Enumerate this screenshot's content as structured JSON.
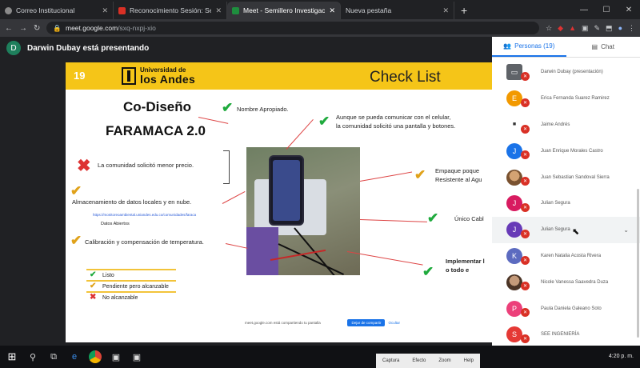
{
  "browser": {
    "tabs": [
      {
        "title": "Correo Institucional",
        "color": "#8a8a8a",
        "active": false
      },
      {
        "title": "Reconocimiento Sesión: Semillero",
        "color": "#d93025",
        "active": false
      },
      {
        "title": "Meet - Semillero Investigac...",
        "color": "#1e8e3e",
        "active": true
      },
      {
        "title": "Nueva pestaña",
        "color": "#5f6368",
        "active": false
      }
    ],
    "new_tab": "+",
    "url_host": "meet.google.com",
    "url_path": "/sxq-nxpj-xio"
  },
  "meet": {
    "presenter_initial": "D",
    "presenting_text": "Darwin Dubay está presentando",
    "notice_text": "meet.google.com está compartiendo tu pantalla",
    "notice_stop": "Dejar de compartir",
    "notice_hide": "Ocultar"
  },
  "slide": {
    "number": "19",
    "uni_line1": "Universidad de",
    "uni_line2": "los Andes",
    "heading": "Check List",
    "title1": "Co-Diseño",
    "title2": "FARAMACA 2.0",
    "items": {
      "nombre": "Nombre Apropiado.",
      "celular": "Aunque se pueda comunicar con el celular,\nla comunidad solicitó una pantalla y botones.",
      "precio": "La comunidad solicitó menor precio.",
      "almacenamiento": "Almacenamiento de datos locales y en nube.",
      "link": "https://monitoreoambiental.uniandes.edu.co/comunidades/faraca",
      "datos": "Datos Abiertos",
      "calibracion": "Calibración y compensación de temperatura.",
      "empaque": "Empaque poque\nResistente al Agu",
      "cable": "Único Cabl",
      "implementar": "Implementar l\no todo e"
    },
    "legend": {
      "listo": "Listo",
      "pendiente": "Pendiente pero alcanzable",
      "no": "No alcanzable"
    },
    "marks": {
      "check": "✔",
      "cross": "✖"
    }
  },
  "panel": {
    "people_tab": "Personas (19)",
    "chat_tab": "Chat",
    "participants": [
      {
        "initial": "",
        "name": "Darwin Dubay (presentación)",
        "color": "#5f6368"
      },
      {
        "initial": "E",
        "name": "Erica Fernanda Suarez Ramirez",
        "color": "#f29900"
      },
      {
        "initial": "",
        "name": "Jaime Andrés",
        "color": "#ffffff"
      },
      {
        "initial": "J",
        "name": "Juan Enrique Morales Castro",
        "color": "#1a73e8"
      },
      {
        "initial": "",
        "name": "Juan Sebastian Sandoval Sierra",
        "color": "#b07a4a"
      },
      {
        "initial": "J",
        "name": "Julian Segura",
        "color": "#d81b60"
      },
      {
        "initial": "J",
        "name": "Julian Segura",
        "color": "#673ab7"
      },
      {
        "initial": "K",
        "name": "Karen Natalia Acosta Rivera",
        "color": "#5c6bc0"
      },
      {
        "initial": "",
        "name": "Nicole Vanessa Saavedra Duza",
        "color": "#8d6e63"
      },
      {
        "initial": "P",
        "name": "Paula Daniela Galeano Soto",
        "color": "#ec407a"
      },
      {
        "initial": "S",
        "name": "SEE INGENIERÍA",
        "color": "#e53935"
      }
    ]
  },
  "controls": {
    "items": [
      "Captura",
      "Efecto",
      "Zoom",
      "Help"
    ]
  },
  "taskbar": {
    "time": "4:20 p. m."
  }
}
